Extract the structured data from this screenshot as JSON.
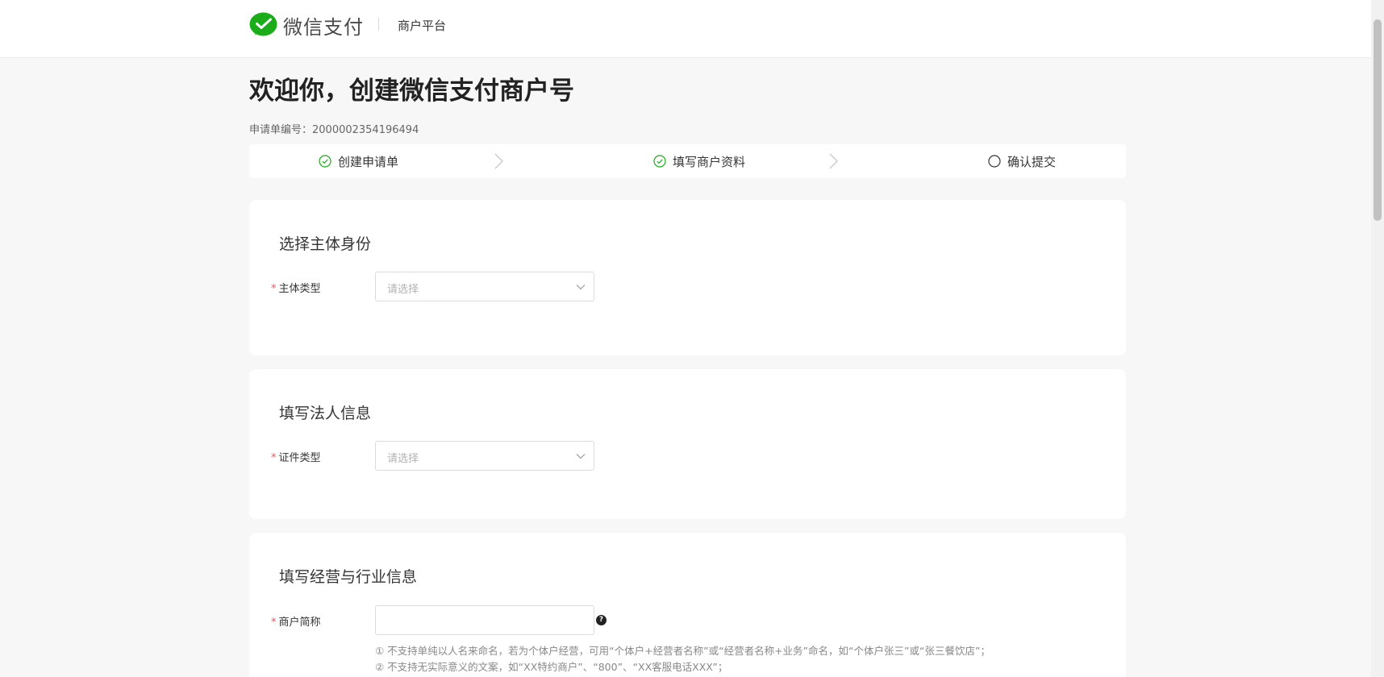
{
  "header": {
    "brand_name": "微信支付",
    "platform_label": "商户平台",
    "logo_icon": "wechat-pay-logo-icon",
    "brand_color": "#1aad19"
  },
  "main": {
    "title": "欢迎你，创建微信支付商户号",
    "application_no_label": "申请单编号：",
    "application_no": "2000002354196494"
  },
  "steps": [
    {
      "label": "创建申请单",
      "status": "done",
      "icon": "check-circle-icon"
    },
    {
      "label": "填写商户资料",
      "status": "done",
      "icon": "check-circle-icon"
    },
    {
      "label": "确认提交",
      "status": "pending",
      "icon": "empty-circle-icon"
    }
  ],
  "sections": {
    "entity": {
      "title": "选择主体身份",
      "field_label": "主体类型",
      "placeholder": "请选择"
    },
    "legal": {
      "title": "填写法人信息",
      "field_label": "证件类型",
      "placeholder": "请选择"
    },
    "business": {
      "title": "填写经营与行业信息",
      "field_label": "商户简称",
      "value": "",
      "help_icon": "question-circle-icon",
      "hints": [
        "① 不支持单纯以人名来命名，若为个体户经营，可用“个体户+经营者名称”或“经营者名称+业务”命名，如“个体户张三”或“张三餐饮店”；",
        "② 不支持无实际意义的文案，如“XX特约商户”、“800”、“XX客服电话XXX”；"
      ]
    }
  },
  "required_mark": "*",
  "colors": {
    "success": "#1aad19",
    "required": "#fa5151"
  }
}
